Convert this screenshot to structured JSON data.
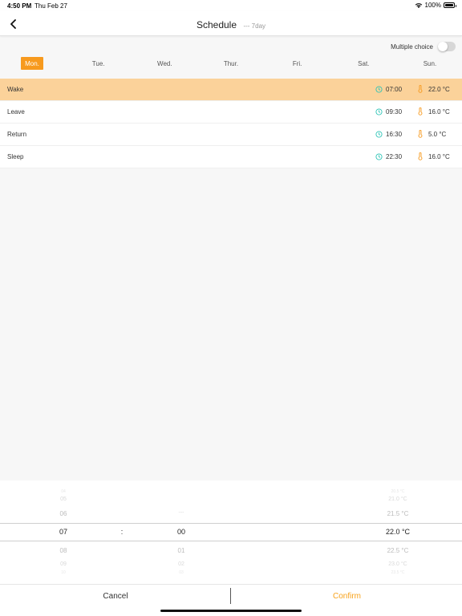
{
  "status_bar": {
    "time": "4:50 PM",
    "date": "Thu Feb 27",
    "battery": "100%"
  },
  "header": {
    "title": "Schedule",
    "subtitle": "--- 7day"
  },
  "multiple_choice": {
    "label": "Multiple choice",
    "enabled": false
  },
  "days": [
    {
      "label": "Mon.",
      "active": true
    },
    {
      "label": "Tue.",
      "active": false
    },
    {
      "label": "Wed.",
      "active": false
    },
    {
      "label": "Thur.",
      "active": false
    },
    {
      "label": "Fri.",
      "active": false
    },
    {
      "label": "Sat.",
      "active": false
    },
    {
      "label": "Sun.",
      "active": false
    }
  ],
  "schedule": [
    {
      "name": "Wake",
      "time": "07:00",
      "temp": "22.0 °C",
      "selected": true
    },
    {
      "name": "Leave",
      "time": "09:30",
      "temp": "16.0 °C",
      "selected": false
    },
    {
      "name": "Return",
      "time": "16:30",
      "temp": "5.0 °C",
      "selected": false
    },
    {
      "name": "Sleep",
      "time": "22:30",
      "temp": "16.0 °C",
      "selected": false
    }
  ],
  "picker": {
    "hour": {
      "sel": "07",
      "above": [
        "06",
        "05",
        "04"
      ],
      "below": [
        "08",
        "09",
        "10"
      ]
    },
    "separator": ":",
    "minute": {
      "sel": "00",
      "above": [
        "---",
        "",
        ""
      ],
      "below": [
        "01",
        "02",
        "03"
      ]
    },
    "temp": {
      "sel": "22.0 °C",
      "above": [
        "21.5 °C",
        "21.0 °C",
        "20.5 °C"
      ],
      "below": [
        "22.5 °C",
        "23.0 °C",
        "23.5 °C"
      ]
    }
  },
  "actions": {
    "cancel": "Cancel",
    "confirm": "Confirm"
  },
  "colors": {
    "accent": "#f79a1e",
    "selected_row": "#fbd29a",
    "clock_icon": "#2ec4b6",
    "thermo_icon": "#f79a1e"
  }
}
